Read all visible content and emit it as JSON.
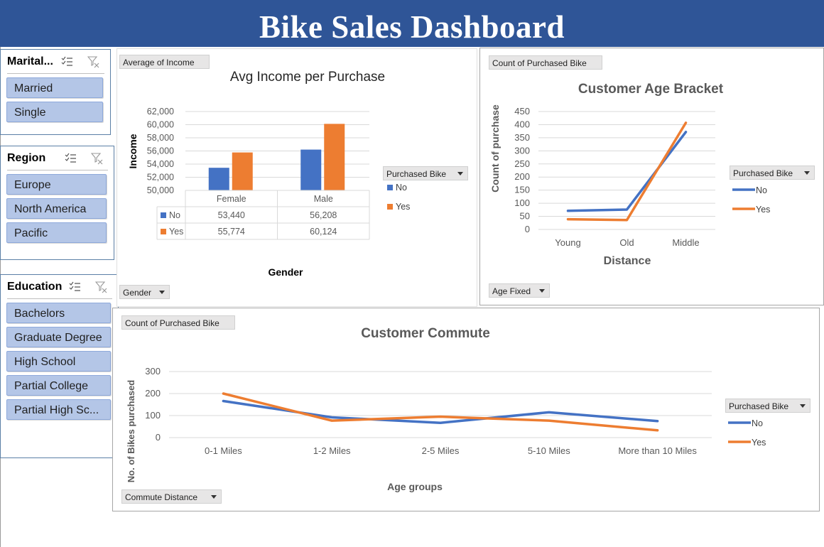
{
  "header": {
    "title": "Bike Sales Dashboard"
  },
  "slicers": {
    "marital": {
      "title": "Marital...",
      "items": [
        "Married",
        "Single"
      ]
    },
    "region": {
      "title": "Region",
      "items": [
        "Europe",
        "North America",
        "Pacific"
      ]
    },
    "education": {
      "title": "Education",
      "items": [
        "Bachelors",
        "Graduate Degree",
        "High School",
        "Partial College",
        "Partial High Sc..."
      ]
    }
  },
  "field_buttons": {
    "income_value": "Average of Income",
    "income_axis": "Gender",
    "income_legend": "Purchased Bike",
    "age_value": "Count of Purchased Bike",
    "age_axis": "Age Fixed",
    "age_legend": "Purchased Bike",
    "commute_value": "Count of Purchased Bike",
    "commute_axis": "Commute Distance",
    "commute_legend": "Purchased Bike"
  },
  "colors": {
    "banner": "#2f5597",
    "no": "#4472c4",
    "yes": "#ed7d31",
    "slicer_button": "#b4c6e7"
  },
  "chart_data": [
    {
      "type": "bar",
      "title": "Avg Income per Purchase",
      "xlabel": "Gender",
      "ylabel": "Income",
      "categories": [
        "Female",
        "Male"
      ],
      "series": [
        {
          "name": "No",
          "values": [
            53440,
            56208
          ]
        },
        {
          "name": "Yes",
          "values": [
            55774,
            60124
          ]
        }
      ],
      "table_values": [
        [
          "53,440",
          "56,208"
        ],
        [
          "55,774",
          "60,124"
        ]
      ],
      "ylim": [
        50000,
        62000
      ],
      "yticks": [
        "50,000",
        "52,000",
        "54,000",
        "56,000",
        "58,000",
        "60,000",
        "62,000"
      ],
      "legend": "right",
      "grid": true
    },
    {
      "type": "line",
      "title": "Customer Age Bracket",
      "xlabel": "Distance",
      "ylabel": "Count of purchase",
      "categories": [
        "Young",
        "Old",
        "Middle"
      ],
      "series": [
        {
          "name": "No",
          "values": [
            71,
            76,
            372
          ]
        },
        {
          "name": "Yes",
          "values": [
            39,
            36,
            407
          ]
        }
      ],
      "ylim": [
        0,
        450
      ],
      "yticks": [
        "0",
        "50",
        "100",
        "150",
        "200",
        "250",
        "300",
        "350",
        "400",
        "450"
      ],
      "legend": "right",
      "grid": true
    },
    {
      "type": "line",
      "title": "Customer Commute",
      "xlabel": "Age groups",
      "ylabel": "No. of Bikes purchased",
      "categories": [
        "0-1 Miles",
        "1-2 Miles",
        "2-5 Miles",
        "5-10 Miles",
        "More than 10 Miles"
      ],
      "series": [
        {
          "name": "No",
          "values": [
            166,
            92,
            67,
            115,
            75
          ]
        },
        {
          "name": "Yes",
          "values": [
            200,
            77,
            95,
            77,
            33
          ]
        }
      ],
      "ylim": [
        0,
        300
      ],
      "yticks": [
        "0",
        "100",
        "200",
        "300"
      ],
      "legend": "right",
      "grid": true
    }
  ]
}
